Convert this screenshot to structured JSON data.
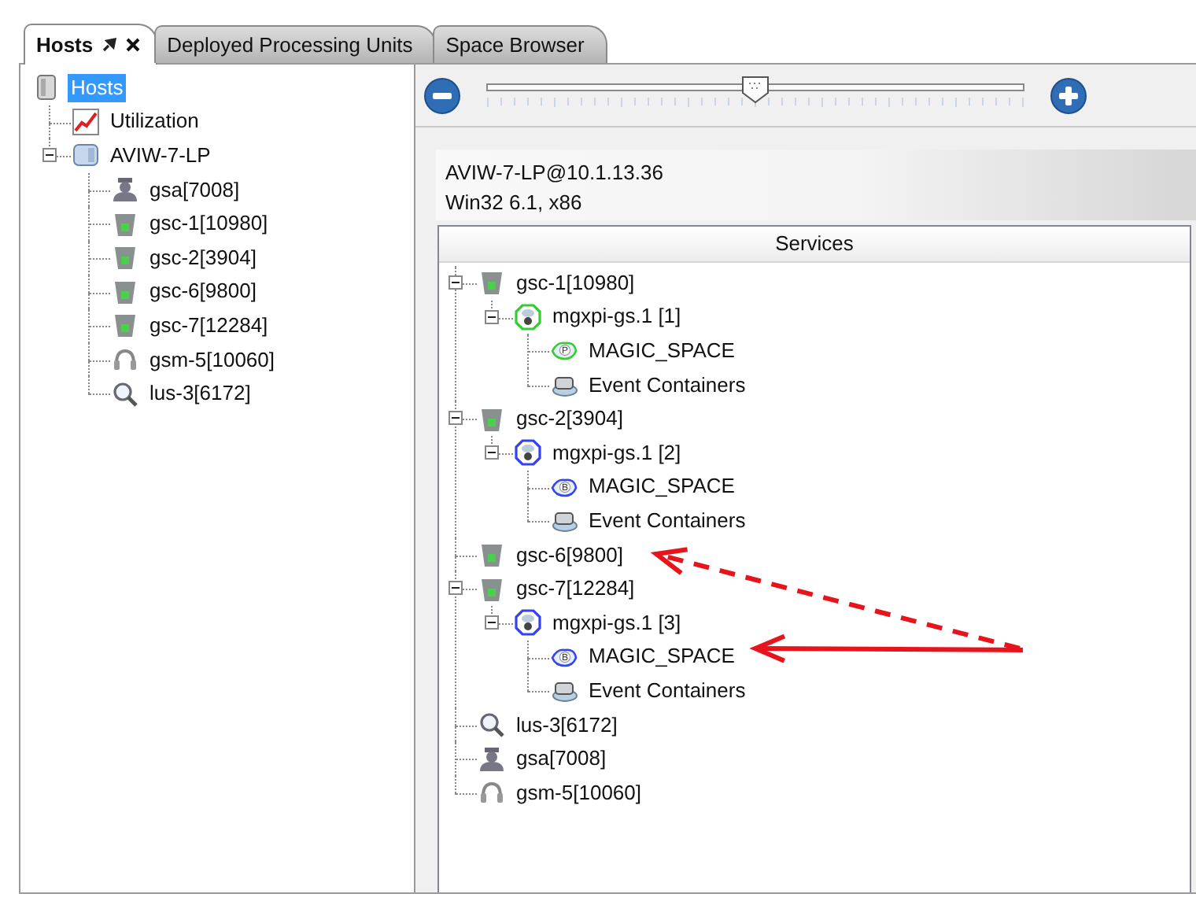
{
  "tabs": [
    {
      "label": "Hosts",
      "selected": true,
      "closable": true
    },
    {
      "label": "Deployed Processing Units",
      "selected": false,
      "closable": false
    },
    {
      "label": "Space Browser",
      "selected": false,
      "closable": false
    }
  ],
  "hosts_tree": [
    {
      "label": "Hosts",
      "kind": "hosts",
      "selected": true,
      "children": [
        {
          "label": "Utilization",
          "kind": "utilization",
          "selected": false
        },
        {
          "label": "AVIW-7-LP",
          "kind": "host",
          "selected": false,
          "expanded": true,
          "children": [
            {
              "label": "gsa[7008]",
              "kind": "agent",
              "selected": false
            },
            {
              "label": "gsc-1[10980]",
              "kind": "container",
              "selected": false
            },
            {
              "label": "gsc-2[3904]",
              "kind": "container",
              "selected": false
            },
            {
              "label": "gsc-6[9800]",
              "kind": "container",
              "selected": false
            },
            {
              "label": "gsc-7[12284]",
              "kind": "container",
              "selected": false
            },
            {
              "label": "gsm-5[10060]",
              "kind": "manager",
              "selected": false
            },
            {
              "label": "lus-3[6172]",
              "kind": "lookup",
              "selected": false
            }
          ]
        }
      ]
    }
  ],
  "zoom": {
    "level": 0.5
  },
  "host_info": {
    "address": "AVIW-7-LP@10.1.13.36",
    "platform": "Win32 6.1, x86"
  },
  "services": {
    "column": "Services",
    "tree": [
      {
        "label": "gsc-1[10980]",
        "kind": "container",
        "selected": false,
        "expanded": true,
        "children": [
          {
            "label": "mgxpi-gs.1 [1]",
            "kind": "pu",
            "color": "#33cc33",
            "selected": false,
            "expanded": true,
            "children": [
              {
                "label": "MAGIC_SPACE",
                "kind": "space",
                "badge": "P",
                "color": "#33cc33",
                "selected": false
              },
              {
                "label": "Event Containers",
                "kind": "events",
                "selected": false
              }
            ]
          }
        ]
      },
      {
        "label": "gsc-2[3904]",
        "kind": "container",
        "selected": false,
        "expanded": true,
        "children": [
          {
            "label": "mgxpi-gs.1 [2]",
            "kind": "pu",
            "color": "#3344ee",
            "selected": false,
            "expanded": true,
            "children": [
              {
                "label": "MAGIC_SPACE",
                "kind": "space",
                "badge": "B",
                "color": "#3344ee",
                "selected": false
              },
              {
                "label": "Event Containers",
                "kind": "events",
                "selected": false
              }
            ]
          }
        ]
      },
      {
        "label": "gsc-6[9800]",
        "kind": "container",
        "selected": false
      },
      {
        "label": "gsc-7[12284]",
        "kind": "container",
        "selected": false,
        "expanded": true,
        "children": [
          {
            "label": "mgxpi-gs.1 [3]",
            "kind": "pu",
            "color": "#3344ee",
            "selected": false,
            "expanded": true,
            "children": [
              {
                "label": "MAGIC_SPACE",
                "kind": "space",
                "badge": "B",
                "color": "#3344ee",
                "selected": false
              },
              {
                "label": "Event Containers",
                "kind": "events",
                "selected": false
              }
            ]
          }
        ]
      },
      {
        "label": "lus-3[6172]",
        "kind": "lookup",
        "selected": false
      },
      {
        "label": "gsa[7008]",
        "kind": "agent",
        "selected": false
      },
      {
        "label": "gsm-5[10060]",
        "kind": "manager",
        "selected": false
      }
    ]
  },
  "annotations": [
    {
      "kind": "dashed"
    },
    {
      "kind": "solid"
    }
  ]
}
